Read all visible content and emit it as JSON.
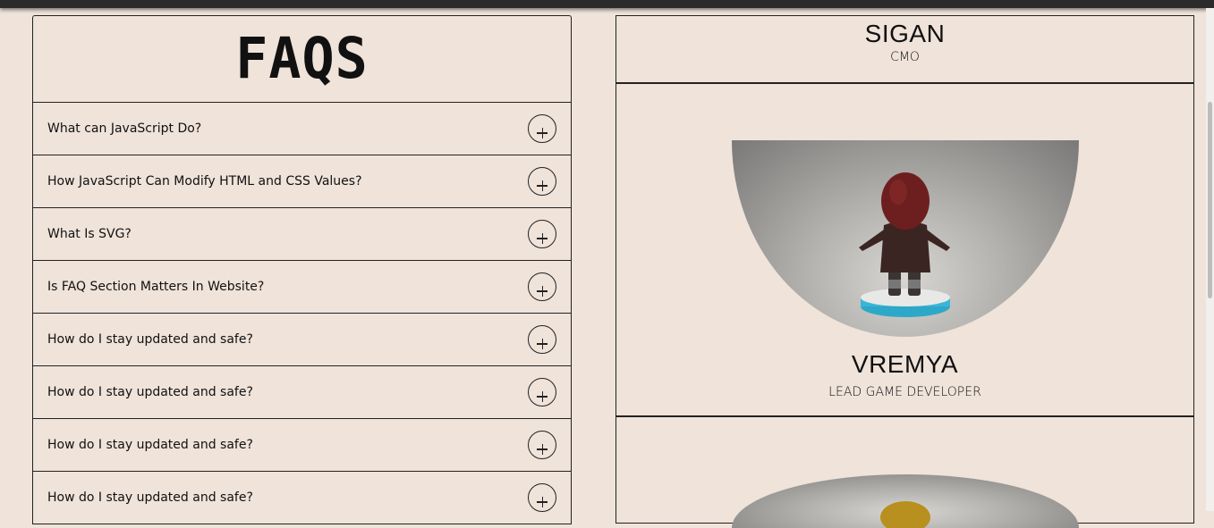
{
  "faq": {
    "title": "FAQS",
    "items": [
      {
        "question": "What can JavaScript Do?"
      },
      {
        "question": "How JavaScript Can Modify HTML and CSS Values?"
      },
      {
        "question": "What Is SVG?"
      },
      {
        "question": "Is FAQ Section Matters In Website?"
      },
      {
        "question": "How do I stay updated and safe?"
      },
      {
        "question": "How do I stay updated and safe?"
      },
      {
        "question": "How do I stay updated and safe?"
      },
      {
        "question": "How do I stay updated and safe?"
      }
    ]
  },
  "team": [
    {
      "name": "SIGAN",
      "role": "CMO"
    },
    {
      "name": "VREMYA",
      "role": "LEAD GAME DEVELOPER"
    }
  ],
  "colors": {
    "background": "#efe3da",
    "border": "#222222",
    "top_bar": "#2b2b2b"
  }
}
